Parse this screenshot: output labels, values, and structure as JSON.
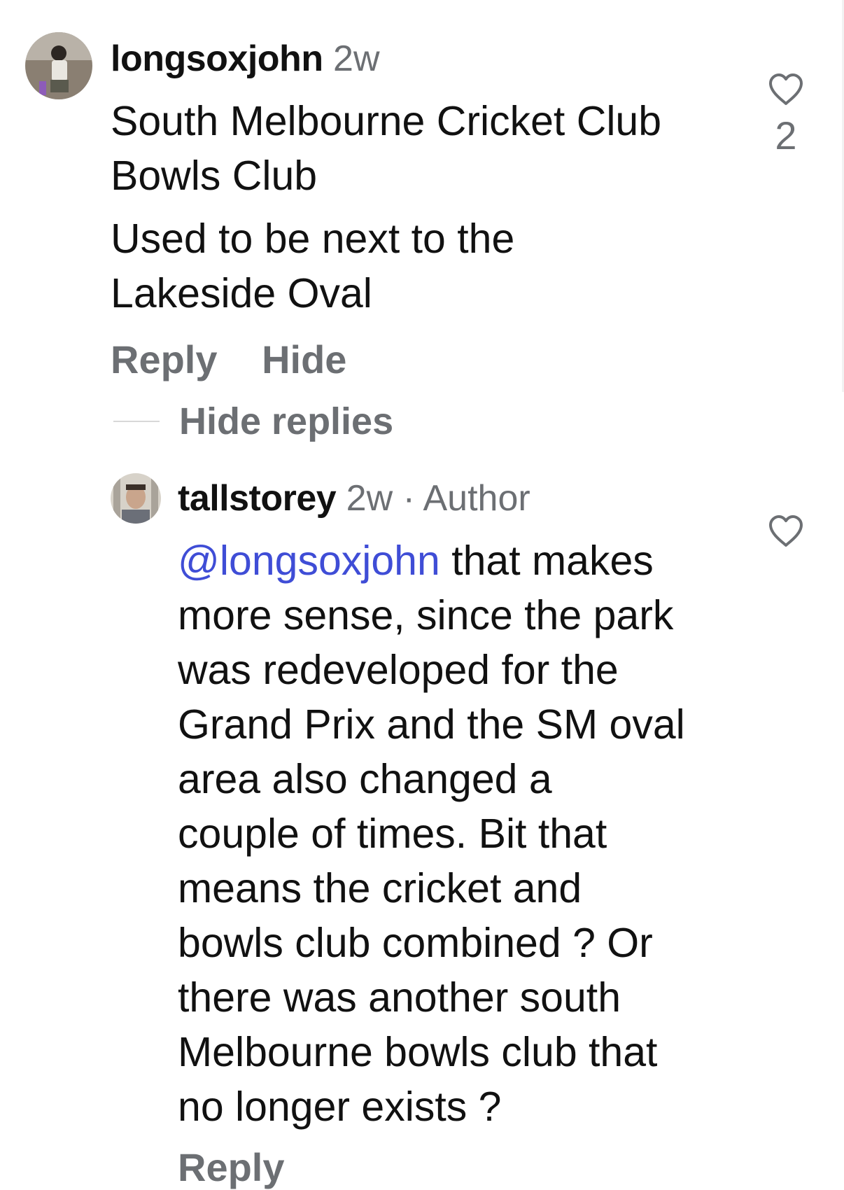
{
  "comments": [
    {
      "username": "longsoxjohn",
      "meta": "2w",
      "lines": [
        "South Melbourne Cricket Club",
        "Bowls Club",
        "Used to be next to the",
        "Lakeside Oval"
      ],
      "like_count": "2",
      "actions": {
        "reply": "Reply",
        "hide": "Hide"
      },
      "hide_replies": "Hide replies",
      "like_icon": "heart-outline-icon"
    },
    {
      "username": "tallstorey",
      "meta": "2w · Author",
      "mention": "@longsoxjohn",
      "first_line_rest": " that makes",
      "lines": [
        "more sense, since the park",
        "was redeveloped for the",
        "Grand Prix and the SM oval",
        "area also changed a",
        "couple of times. Bit that",
        "means the cricket and",
        "bowls club combined ? Or",
        "there was another south",
        "Melbourne bowls club that",
        "no longer exists ?"
      ],
      "actions": {
        "reply": "Reply"
      },
      "like_icon": "heart-outline-icon"
    }
  ],
  "colors": {
    "text": "#111111",
    "muted": "#6c6f73",
    "mention": "#3f4dd6"
  }
}
